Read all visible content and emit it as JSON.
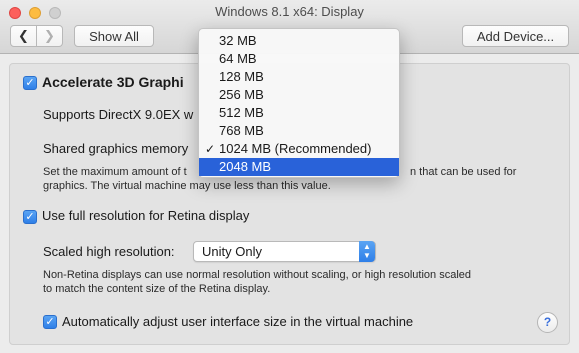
{
  "window": {
    "title": "Windows 8.1 x64: Display"
  },
  "toolbar": {
    "back_icon": "chevron-left-icon",
    "back_glyph": "❮",
    "forward_icon": "chevron-right-icon",
    "forward_glyph": "❯",
    "show_all_label": "Show All",
    "add_device_label": "Add Device..."
  },
  "graphics": {
    "accelerate_label": "Accelerate 3D Graphi",
    "accelerate_checked": true,
    "supports_label": "Supports DirectX 9.0EX w",
    "shared_memory_label": "Shared graphics memory",
    "description_line1": "Set the maximum amount of t",
    "description_line1_tail": "n that can be used for",
    "description_line2": "graphics. The virtual machine may use less than this value."
  },
  "retina": {
    "full_resolution_label": "Use full resolution for Retina display",
    "full_resolution_checked": true,
    "scaled_label": "Scaled high resolution:",
    "scaled_value": "Unity Only",
    "note_line1": "Non-Retina displays can use normal resolution without scaling, or high resolution scaled",
    "note_line2": "to match the content size of the Retina display.",
    "auto_adjust_label": "Automatically adjust user interface size in the virtual machine",
    "auto_adjust_checked": true
  },
  "memory_menu": {
    "options": [
      {
        "label": "32 MB",
        "checked": false,
        "highlighted": false
      },
      {
        "label": "64 MB",
        "checked": false,
        "highlighted": false
      },
      {
        "label": "128 MB",
        "checked": false,
        "highlighted": false
      },
      {
        "label": "256 MB",
        "checked": false,
        "highlighted": false
      },
      {
        "label": "512 MB",
        "checked": false,
        "highlighted": false
      },
      {
        "label": "768 MB",
        "checked": false,
        "highlighted": false
      },
      {
        "label": "1024 MB (Recommended)",
        "checked": true,
        "highlighted": false
      },
      {
        "label": "2048 MB",
        "checked": false,
        "highlighted": true
      }
    ]
  },
  "help": {
    "glyph": "?"
  },
  "colors": {
    "accent": "#2f7fe8",
    "menu_highlight": "#2962d9"
  }
}
